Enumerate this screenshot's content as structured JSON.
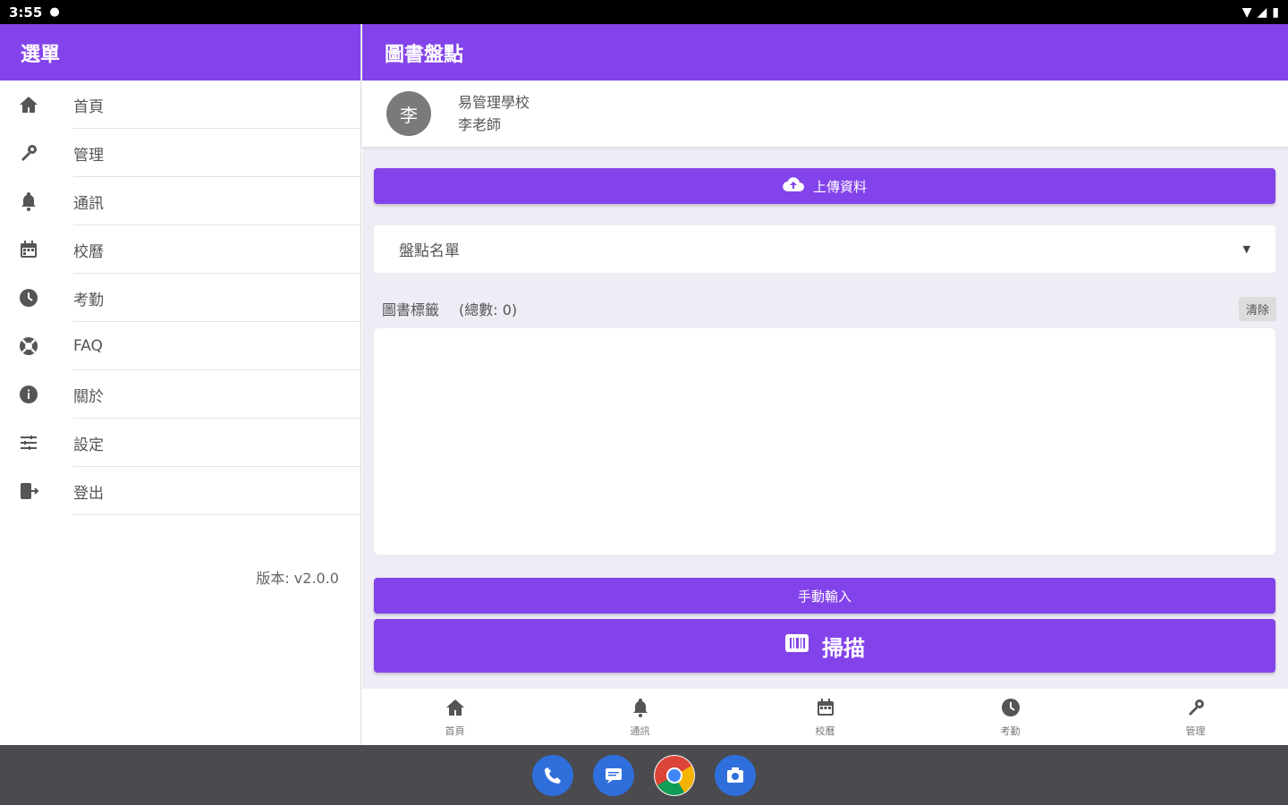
{
  "status_bar": {
    "time": "3:55"
  },
  "drawer": {
    "title": "選單",
    "items": [
      {
        "label": "首頁",
        "icon": "home-icon"
      },
      {
        "label": "管理",
        "icon": "wrench-icon"
      },
      {
        "label": "通訊",
        "icon": "bell-icon"
      },
      {
        "label": "校曆",
        "icon": "calendar-icon"
      },
      {
        "label": "考勤",
        "icon": "clock-icon"
      },
      {
        "label": "FAQ",
        "icon": "lifebuoy-icon"
      },
      {
        "label": "關於",
        "icon": "info-icon"
      },
      {
        "label": "設定",
        "icon": "sliders-icon"
      },
      {
        "label": "登出",
        "icon": "logout-icon"
      }
    ],
    "version": "版本: v2.0.0"
  },
  "main": {
    "title": "圖書盤點",
    "profile": {
      "avatar_text": "李",
      "school": "易管理學校",
      "teacher": "李老師"
    },
    "upload_label": "上傳資料",
    "select_value": "盤點名單",
    "tags_label": "圖書標籤",
    "tags_count": "(總數: 0)",
    "clear_label": "清除",
    "manual_label": "手動輸入",
    "scan_label": "掃描"
  },
  "bottom_nav": [
    {
      "label": "首頁",
      "icon": "home-icon"
    },
    {
      "label": "通訊",
      "icon": "bell-icon"
    },
    {
      "label": "校曆",
      "icon": "calendar-icon"
    },
    {
      "label": "考勤",
      "icon": "clock-icon"
    },
    {
      "label": "管理",
      "icon": "wrench-icon"
    }
  ],
  "dock": [
    "phone-icon",
    "messages-icon",
    "chrome-icon",
    "camera-icon"
  ],
  "colors": {
    "primary": "#8343ea",
    "background": "#efecf5"
  }
}
